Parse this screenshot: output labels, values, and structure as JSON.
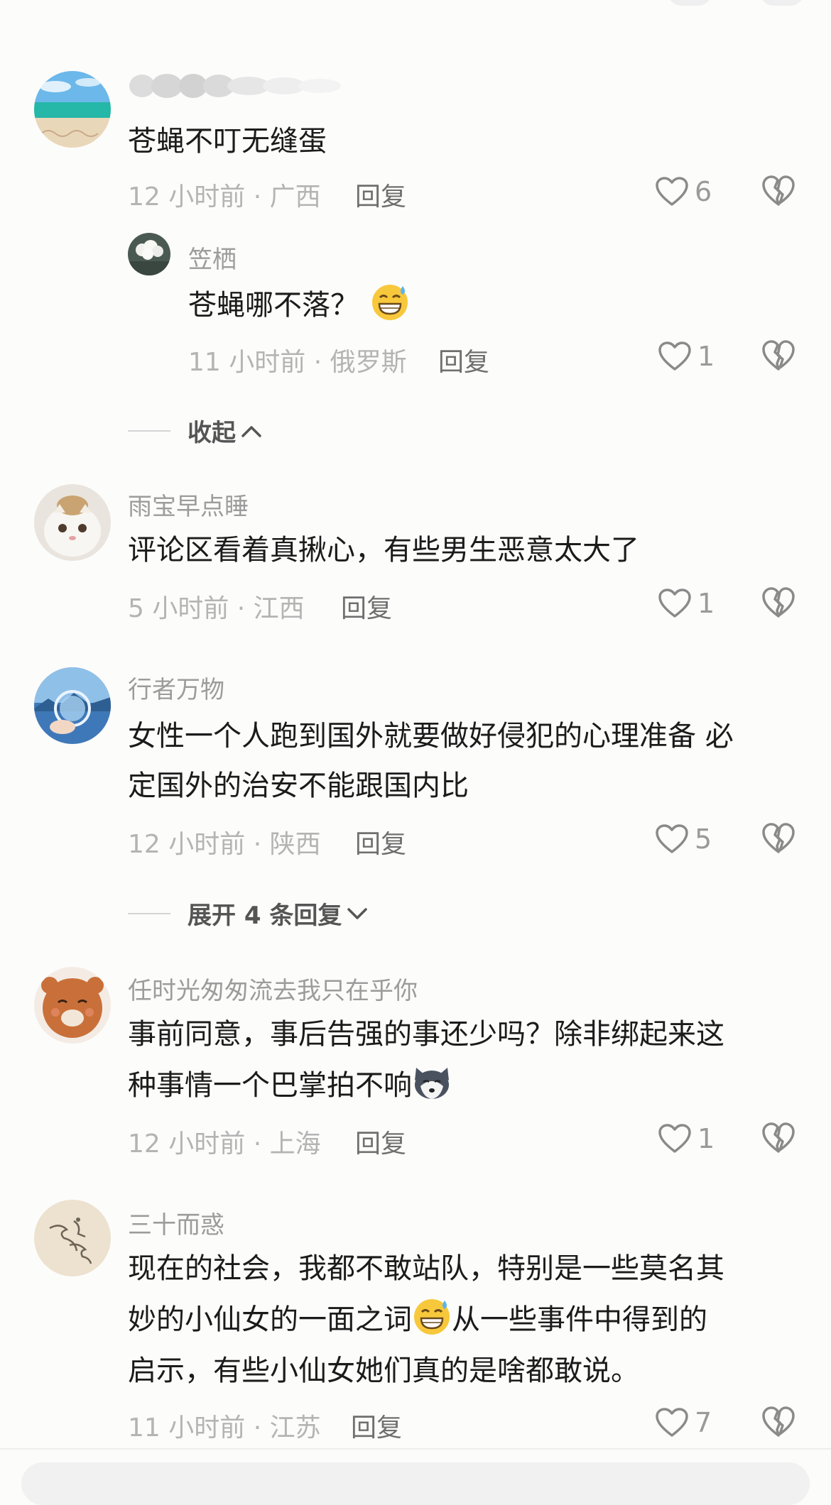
{
  "comments": [
    {
      "username": "",
      "text": "苍蝇不叮无缝蛋",
      "meta": "12 小时前 · 广西",
      "reply": "回复",
      "likes": "6",
      "replies": [
        {
          "username": "笠栖",
          "text": "苍蝇哪不落？",
          "meta": "11 小时前 · 俄罗斯",
          "reply": "回复",
          "likes": "1"
        }
      ],
      "fold_label": "收起"
    },
    {
      "username": "雨宝早点睡",
      "text": "评论区看着真揪心，有些男生恶意太大了",
      "meta": "5 小时前 · 江西",
      "reply": "回复",
      "likes": "1"
    },
    {
      "username": "行者万物",
      "text_lines": [
        "女性一个人跑到国外就要做好侵犯的心理准备 必",
        "定国外的治安不能跟国内比"
      ],
      "meta": "12 小时前 · 陕西",
      "reply": "回复",
      "likes": "5",
      "expand_label": "展开 4 条回复"
    },
    {
      "username": "任时光匆匆流去我只在乎你",
      "text_lines": [
        "事前同意，事后告强的事还少吗？除非绑起来这",
        "种事情一个巴掌拍不响"
      ],
      "meta": "12 小时前 · 上海",
      "reply": "回复",
      "likes": "1"
    },
    {
      "username": "三十而惑",
      "text_lines": [
        "现在的社会，我都不敢站队，特别是一些莫名其",
        "妙的小仙女的一面之词",
        "从一些事件中得到的",
        "启示，有些小仙女她们真的是啥都敢说。"
      ],
      "meta": "11 小时前 · 江苏",
      "reply": "回复",
      "likes": "7"
    }
  ],
  "icons": [
    "heart-outline-icon",
    "broken-heart-icon",
    "chevron-up-icon",
    "chevron-down-icon",
    "grin-sweat-emoji",
    "husky-emoji"
  ],
  "colors": {
    "background": "#fcfcfb",
    "text": "#1b1b1b",
    "meta": "#b4b4b4",
    "username": "#9c9c9c"
  }
}
